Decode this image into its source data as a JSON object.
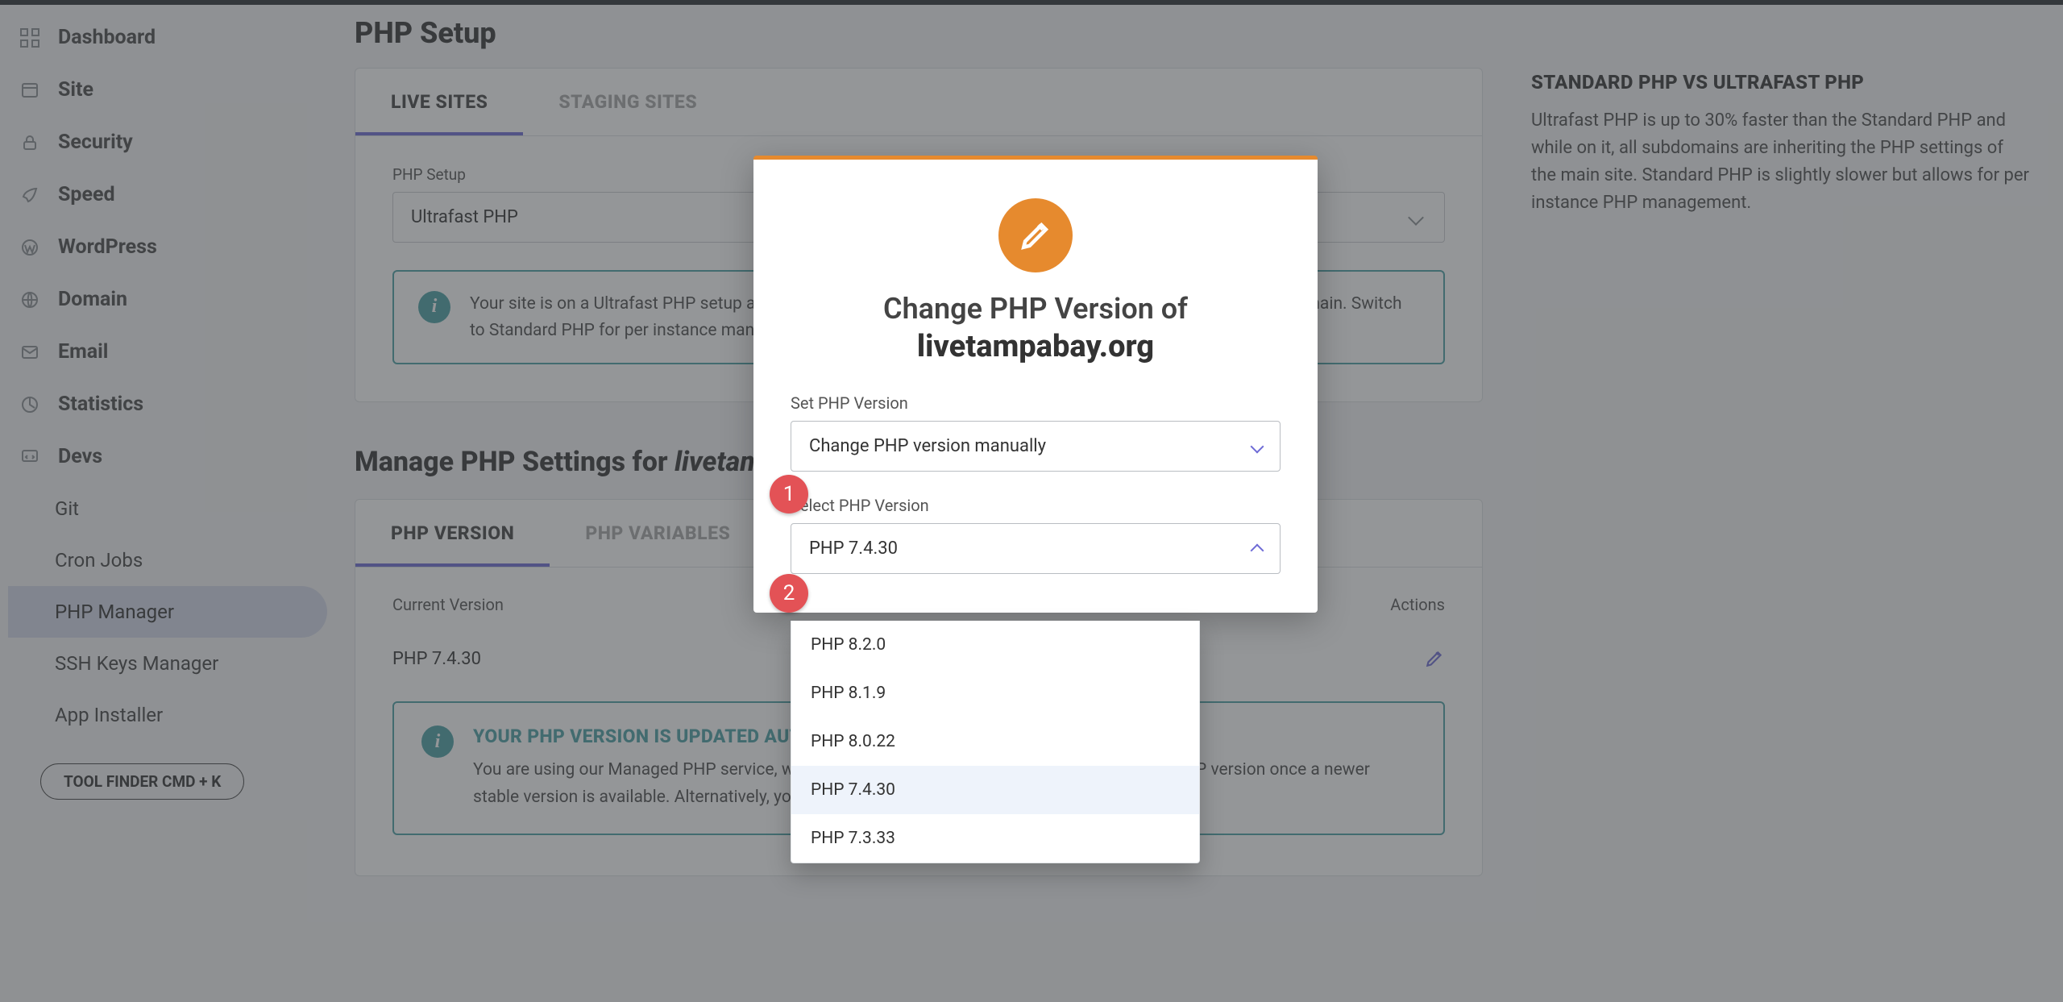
{
  "sidebar": {
    "items": [
      {
        "label": "Dashboard"
      },
      {
        "label": "Site"
      },
      {
        "label": "Security"
      },
      {
        "label": "Speed"
      },
      {
        "label": "WordPress"
      },
      {
        "label": "Domain"
      },
      {
        "label": "Email"
      },
      {
        "label": "Statistics"
      },
      {
        "label": "Devs"
      }
    ],
    "sub_items": [
      {
        "label": "Git"
      },
      {
        "label": "Cron Jobs"
      },
      {
        "label": "PHP Manager"
      },
      {
        "label": "SSH Keys Manager"
      },
      {
        "label": "App Installer"
      }
    ],
    "tool_finder": "TOOL FINDER CMD + K"
  },
  "page": {
    "title": "PHP Setup",
    "tabs": {
      "live": "LIVE SITES",
      "staging": "STAGING SITES"
    },
    "field_label": "PHP Setup",
    "select_value": "Ultrafast PHP",
    "info": "Your site is on a Ultrafast PHP setup and all your subdomains will inherit the PHP settings of the primary site domain. Switch to Standard PHP for per instance management."
  },
  "aside": {
    "heading": "STANDARD PHP VS ULTRAFAST PHP",
    "body": "Ultrafast PHP is up to 30% faster than the Standard PHP and while on it, all subdomains are inheriting the PHP settings of the main site. Standard PHP is slightly slower but allows for per instance PHP management."
  },
  "manage": {
    "title_prefix": "Manage PHP Settings for ",
    "title_domain": "livetampabay.org",
    "tabs": {
      "version": "PHP VERSION",
      "vars": "PHP VARIABLES"
    },
    "col_version": "Current Version",
    "col_actions": "Actions",
    "current_version": "PHP 7.4.30",
    "callout_title": "YOUR PHP VERSION IS UPDATED AUTOMATICALLY",
    "callout_body": "You are using our Managed PHP service, which means that we will automatically update your PHP version once a newer stable version is available. Alternatively, you can choose to manually change your PHP version."
  },
  "modal": {
    "title_line1": "Change PHP Version of",
    "title_domain": "livetampabay.org",
    "set_label": "Set PHP Version",
    "set_value": "Change PHP version manually",
    "select_label": "Select PHP Version",
    "select_value": "PHP 7.4.30",
    "options": [
      "PHP 8.2.0",
      "PHP 8.1.9",
      "PHP 8.0.22",
      "PHP 7.4.30",
      "PHP 7.3.33"
    ],
    "step1": "1",
    "step2": "2"
  }
}
